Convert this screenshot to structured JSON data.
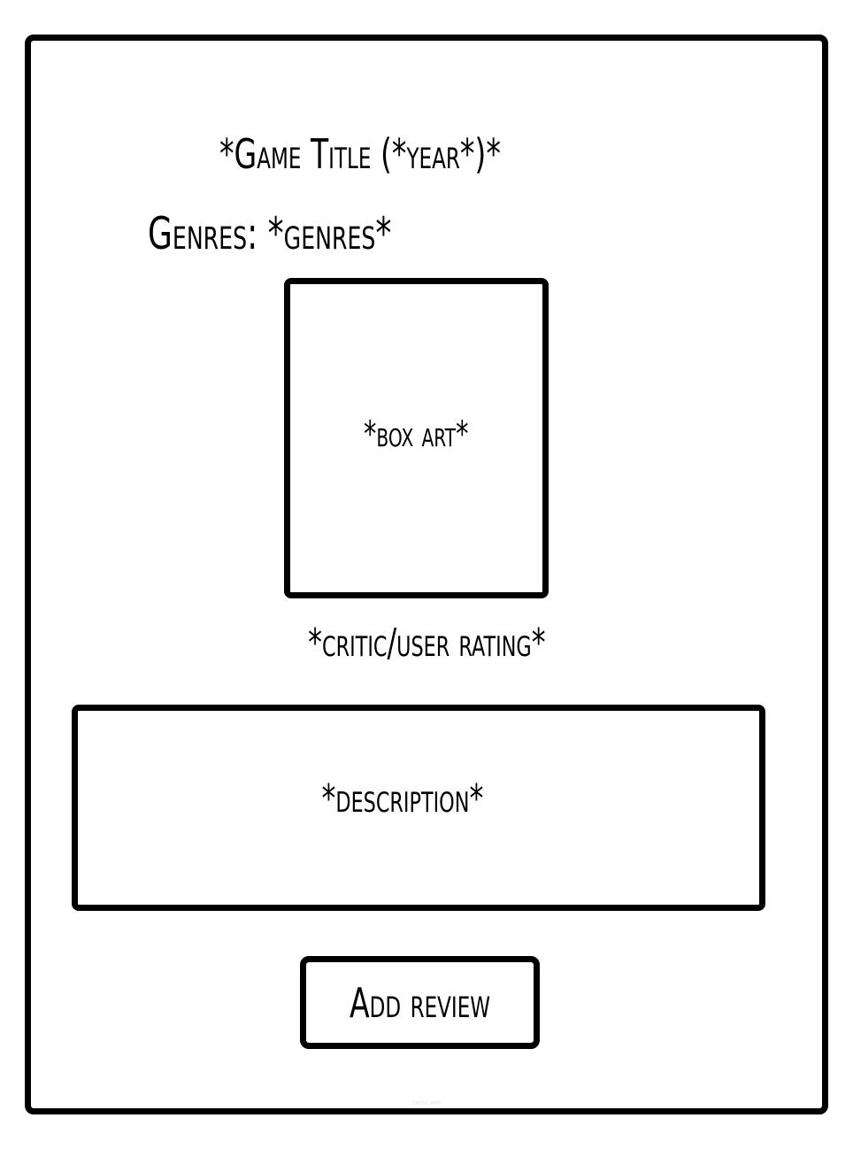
{
  "page": {
    "title": "*Game Title (*year*)*",
    "genres_line": "Genres: *genres*",
    "box_art_placeholder": "*box art*",
    "rating_placeholder": "*critic/user rating*",
    "description_placeholder": "*description*",
    "add_review_label": "Add review",
    "watermark": "okso.app"
  },
  "colors": {
    "stroke": "#000000",
    "background": "#ffffff"
  }
}
